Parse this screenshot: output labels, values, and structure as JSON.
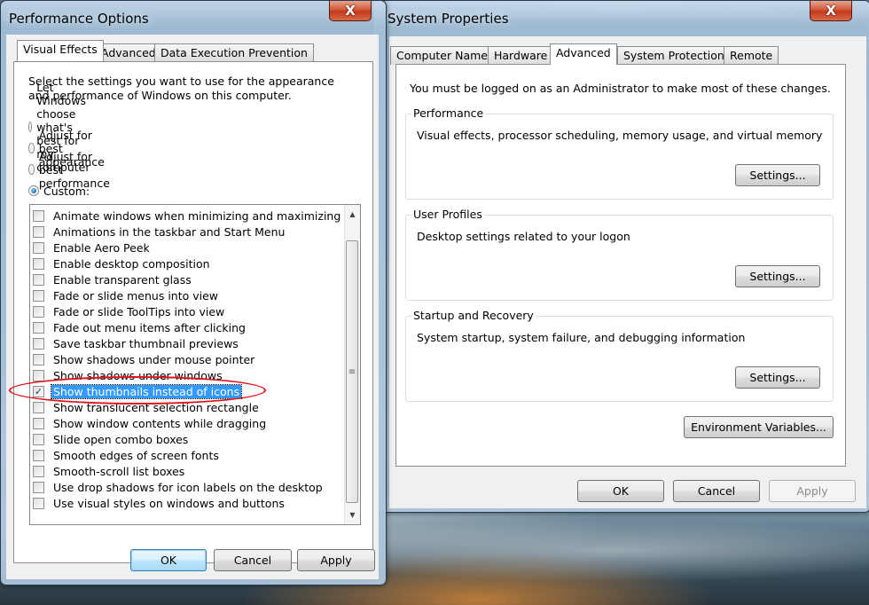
{
  "sys_window": {
    "title": "System Properties",
    "close_glyph": "X",
    "tabs": [
      "Computer Name",
      "Hardware",
      "Advanced",
      "System Protection",
      "Remote"
    ],
    "active_tab": "Advanced",
    "admin_note": "You must be logged on as an Administrator to make most of these changes.",
    "groups": [
      {
        "title": "Performance",
        "description": "Visual effects, processor scheduling, memory usage, and virtual memory",
        "button": "Settings..."
      },
      {
        "title": "User Profiles",
        "description": "Desktop settings related to your logon",
        "button": "Settings..."
      },
      {
        "title": "Startup and Recovery",
        "description": "System startup, system failure, and debugging information",
        "button": "Settings..."
      }
    ],
    "env_button": "Environment Variables...",
    "buttons": {
      "ok": "OK",
      "cancel": "Cancel",
      "apply": "Apply"
    }
  },
  "perf_window": {
    "title": "Performance Options",
    "close_glyph": "X",
    "tabs": [
      "Visual Effects",
      "Advanced",
      "Data Execution Prevention"
    ],
    "active_tab": "Visual Effects",
    "instructions": "Select the settings you want to use for the appearance and performance of Windows on this computer.",
    "radio_options": [
      {
        "label": "Let Windows choose what's best for my computer",
        "checked": false
      },
      {
        "label": "Adjust for best appearance",
        "checked": false
      },
      {
        "label": "Adjust for best performance",
        "checked": false
      },
      {
        "label": "Custom:",
        "checked": true
      }
    ],
    "effects": [
      {
        "label": "Animate windows when minimizing and maximizing",
        "checked": false
      },
      {
        "label": "Animations in the taskbar and Start Menu",
        "checked": false
      },
      {
        "label": "Enable Aero Peek",
        "checked": false
      },
      {
        "label": "Enable desktop composition",
        "checked": false
      },
      {
        "label": "Enable transparent glass",
        "checked": false
      },
      {
        "label": "Fade or slide menus into view",
        "checked": false
      },
      {
        "label": "Fade or slide ToolTips into view",
        "checked": false
      },
      {
        "label": "Fade out menu items after clicking",
        "checked": false
      },
      {
        "label": "Save taskbar thumbnail previews",
        "checked": false
      },
      {
        "label": "Show shadows under mouse pointer",
        "checked": false
      },
      {
        "label": "Show shadows under windows",
        "checked": false
      },
      {
        "label": "Show thumbnails instead of icons",
        "checked": true,
        "selected": true
      },
      {
        "label": "Show translucent selection rectangle",
        "checked": false
      },
      {
        "label": "Show window contents while dragging",
        "checked": false
      },
      {
        "label": "Slide open combo boxes",
        "checked": false
      },
      {
        "label": "Smooth edges of screen fonts",
        "checked": false
      },
      {
        "label": "Smooth-scroll list boxes",
        "checked": false
      },
      {
        "label": "Use drop shadows for icon labels on the desktop",
        "checked": false
      },
      {
        "label": "Use visual styles on windows and buttons",
        "checked": false
      }
    ],
    "check_glyph": "✓",
    "buttons": {
      "ok": "OK",
      "cancel": "Cancel",
      "apply": "Apply"
    }
  }
}
